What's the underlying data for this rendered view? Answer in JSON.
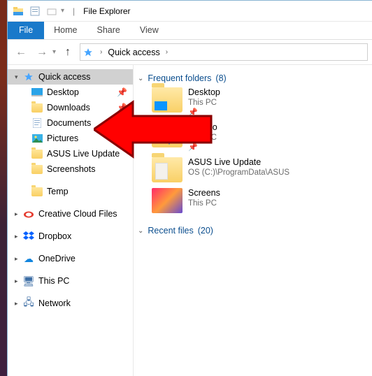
{
  "titlebar": {
    "title": "File Explorer"
  },
  "ribbon": {
    "file": "File",
    "tabs": [
      "Home",
      "Share",
      "View"
    ]
  },
  "addressbar": {
    "root": "Quick access"
  },
  "sidebar": {
    "quick_access": "Quick access",
    "pinned": [
      {
        "label": "Desktop",
        "icon": "desktop"
      },
      {
        "label": "Downloads",
        "icon": "folder"
      },
      {
        "label": "Documents",
        "icon": "doc"
      },
      {
        "label": "Pictures",
        "icon": "pic"
      }
    ],
    "recent": [
      {
        "label": "ASUS Live Update"
      },
      {
        "label": "Screenshots"
      },
      {
        "label": "Temp"
      }
    ],
    "roots": [
      {
        "label": "Creative Cloud Files",
        "icon": "cc"
      },
      {
        "label": "Dropbox",
        "icon": "dropbox"
      },
      {
        "label": "OneDrive",
        "icon": "onedrive"
      },
      {
        "label": "This PC",
        "icon": "pc"
      },
      {
        "label": "Network",
        "icon": "network"
      }
    ]
  },
  "pane": {
    "group1": {
      "title": "Frequent folders",
      "count": "(8)"
    },
    "group2": {
      "title": "Recent files",
      "count": "(20)"
    },
    "tiles": [
      {
        "name": "Desktop",
        "sub": "This PC",
        "kind": "desktop",
        "pinned": true
      },
      {
        "name": "Downlo",
        "sub": "This PC",
        "kind": "downloads",
        "pinned": true
      },
      {
        "name": "ASUS Live Update",
        "sub": "OS (C:)\\ProgramData\\ASUS",
        "kind": "asus",
        "pinned": false
      },
      {
        "name": "Screens",
        "sub": "This PC",
        "kind": "pic",
        "pinned": false
      }
    ]
  }
}
